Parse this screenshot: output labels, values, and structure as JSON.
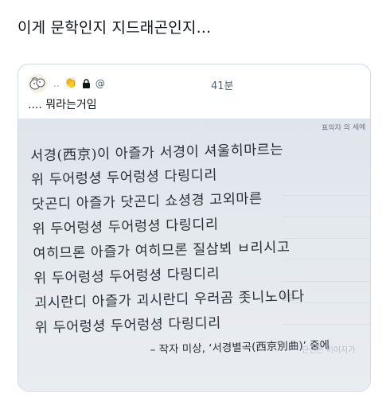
{
  "post": {
    "text": "이게 문학인지 지드래곤인지..."
  },
  "quoted": {
    "display_name": "..",
    "handle_prefix": "@",
    "time_suffix": "41분",
    "text": ".... 뭐라는거임",
    "lock_icon": "lock-icon",
    "emoji": "👏"
  },
  "photo": {
    "page_header": "표의자 의 세예",
    "poem_lines": [
      "서경(西京)이 아즐가 서경이 셔울히마르는",
      "위 두어렁셩 두어렁셩 다링디리",
      "닷곤디 아즐가 닷곤디 쇼셩경 고외마른",
      "위 두어렁셩 두어렁셩 다링디리",
      "여히므론 아즐가 여히므론 질삼뵈 ㅂ리시고",
      "위 두어렁셩 두어렁셩 다링디리",
      "괴시란디 아즐가 괴시란디 우러곰 좃니노이다",
      "위 두어렁셩 두어렁셩 다링디리"
    ],
    "attribution": "– 작자 미상, ‘서경별곡(西京別曲)’ 중에",
    "faded_text_1": "단선은 이어지가",
    "faded_text_2": "질문"
  }
}
